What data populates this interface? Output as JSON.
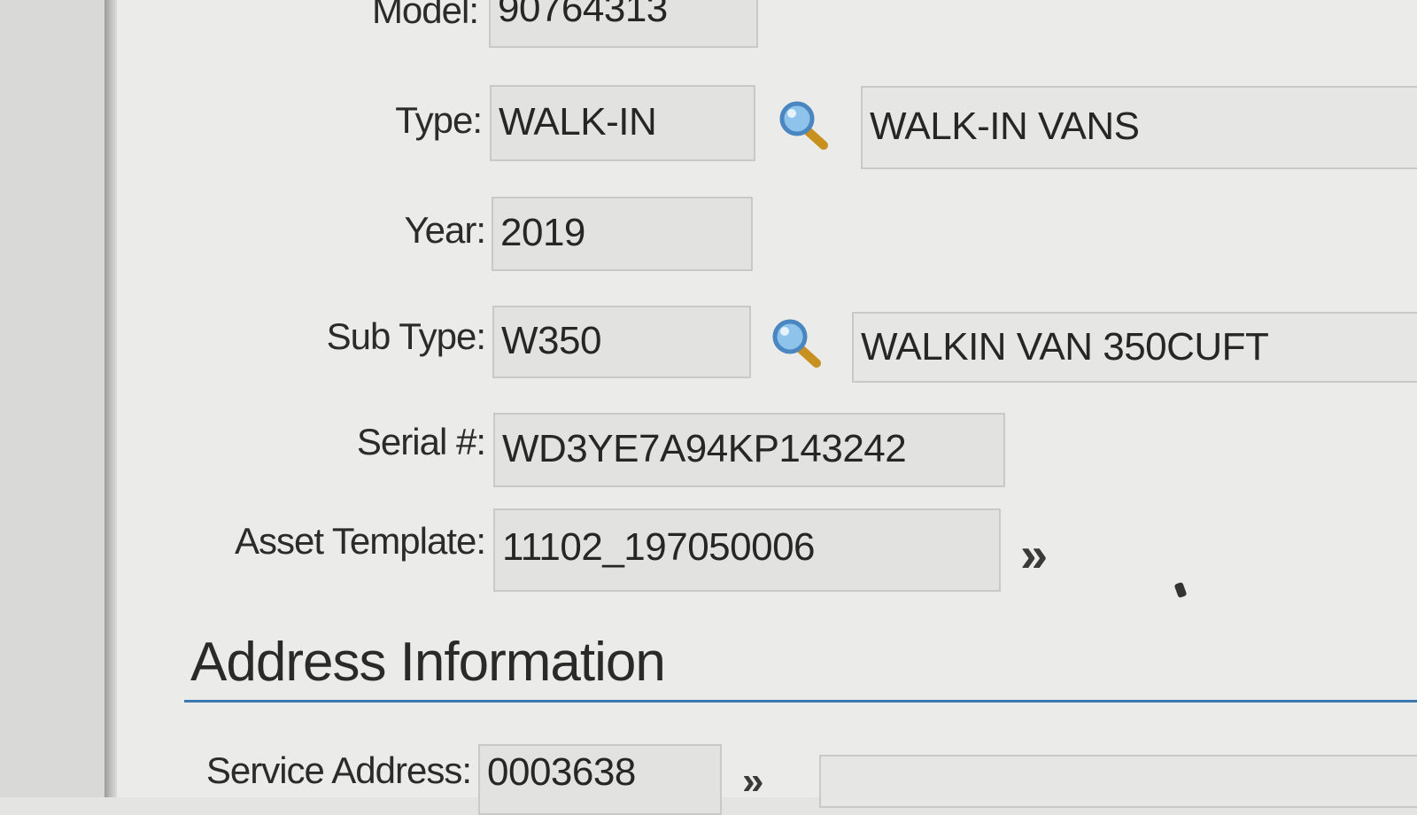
{
  "asset_form": {
    "model": {
      "label": "Model:",
      "value": "90764313"
    },
    "type": {
      "label": "Type:",
      "value": "WALK-IN",
      "description": "WALK-IN VANS"
    },
    "year": {
      "label": "Year:",
      "value": "2019"
    },
    "sub_type": {
      "label": "Sub Type:",
      "value": "W350",
      "description": "WALKIN VAN 350CUFT"
    },
    "serial": {
      "label": "Serial #:",
      "value": "WD3YE7A94KP143242"
    },
    "asset_template": {
      "label": "Asset Template:",
      "value": "11102_197050006",
      "action_glyph": "»"
    }
  },
  "address_section": {
    "title": "Address Information",
    "service_address": {
      "label": "Service Address:",
      "value": "0003638"
    }
  },
  "icons": {
    "lookup": "magnifier-lookup-icon",
    "navigate": "double-chevron-right-icon"
  },
  "colors": {
    "section_rule": "#3a78b0",
    "lookup_lens": "#5aa0d8",
    "lookup_handle": "#c8901e"
  }
}
